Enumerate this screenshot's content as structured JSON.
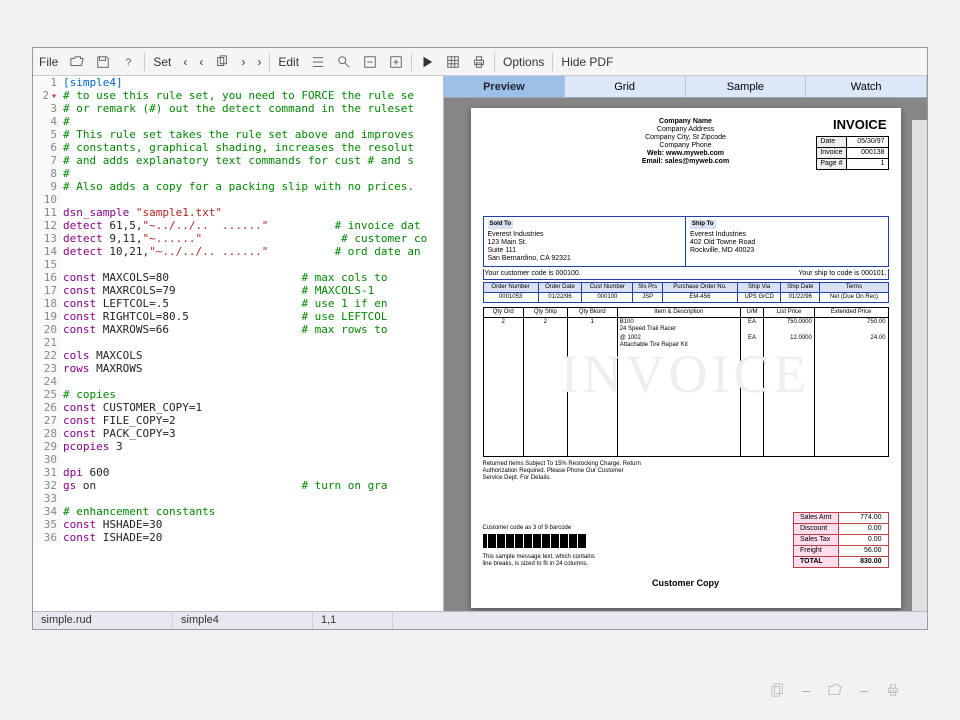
{
  "toolbar": {
    "file": "File",
    "set": "Set",
    "edit": "Edit",
    "options": "Options",
    "hide_pdf": "Hide PDF"
  },
  "code": [
    {
      "n": 1,
      "c": "section",
      "t": "[simple4]"
    },
    {
      "n": 2,
      "c": "comment",
      "t": "# to use this rule set, you need to FORCE the rule se",
      "fold": true
    },
    {
      "n": 3,
      "c": "comment",
      "t": "# or remark (#) out the detect command in the ruleset"
    },
    {
      "n": 4,
      "c": "comment",
      "t": "#"
    },
    {
      "n": 5,
      "c": "comment",
      "t": "# This rule set takes the rule set above and improves"
    },
    {
      "n": 6,
      "c": "comment",
      "t": "# constants, graphical shading, increases the resolut"
    },
    {
      "n": 7,
      "c": "comment",
      "t": "# and adds explanatory text commands for cust # and s"
    },
    {
      "n": 8,
      "c": "comment",
      "t": "#"
    },
    {
      "n": 9,
      "c": "comment",
      "t": "# Also adds a copy for a packing slip with no prices."
    },
    {
      "n": 10,
      "c": "",
      "t": ""
    },
    {
      "n": 11,
      "c": "mixed",
      "t": [
        "kw:dsn_sample ",
        "str:\"sample1.txt\""
      ]
    },
    {
      "n": 12,
      "c": "mixed",
      "t": [
        "kw:detect ",
        "num:61,5,",
        "str:\"~../../..  ......\"",
        "pad:          ",
        "cm:# invoice dat"
      ]
    },
    {
      "n": 13,
      "c": "mixed",
      "t": [
        "kw:detect ",
        "num:9,11,",
        "str:\"~......\"",
        "pad:                     ",
        "cm:# customer co"
      ]
    },
    {
      "n": 14,
      "c": "mixed",
      "t": [
        "kw:detect ",
        "num:10,21,",
        "str:\"~../../.. ......\"",
        "pad:          ",
        "cm:# ord date an"
      ]
    },
    {
      "n": 15,
      "c": "",
      "t": ""
    },
    {
      "n": 16,
      "c": "mixed",
      "t": [
        "kw:const ",
        "id:MAXCOLS=80",
        "pad:                    ",
        "cm:# max cols to"
      ]
    },
    {
      "n": 17,
      "c": "mixed",
      "t": [
        "kw:const ",
        "id:MAXRCOLS=79",
        "pad:                   ",
        "cm:# MAXCOLS-1"
      ]
    },
    {
      "n": 18,
      "c": "mixed",
      "t": [
        "kw:const ",
        "id:LEFTCOL=.5",
        "pad:                    ",
        "cm:# use 1 if en"
      ]
    },
    {
      "n": 19,
      "c": "mixed",
      "t": [
        "kw:const ",
        "id:RIGHTCOL=80.5",
        "pad:                 ",
        "cm:# use LEFTCOL"
      ]
    },
    {
      "n": 20,
      "c": "mixed",
      "t": [
        "kw:const ",
        "id:MAXROWS=66",
        "pad:                    ",
        "cm:# max rows to"
      ]
    },
    {
      "n": 21,
      "c": "",
      "t": ""
    },
    {
      "n": 22,
      "c": "mixed",
      "t": [
        "kw:cols ",
        "id:MAXCOLS"
      ]
    },
    {
      "n": 23,
      "c": "mixed",
      "t": [
        "kw:rows ",
        "id:MAXROWS"
      ]
    },
    {
      "n": 24,
      "c": "",
      "t": ""
    },
    {
      "n": 25,
      "c": "comment",
      "t": "# copies"
    },
    {
      "n": 26,
      "c": "mixed",
      "t": [
        "kw:const ",
        "id:CUSTOMER_COPY=1"
      ]
    },
    {
      "n": 27,
      "c": "mixed",
      "t": [
        "kw:const ",
        "id:FILE_COPY=2"
      ]
    },
    {
      "n": 28,
      "c": "mixed",
      "t": [
        "kw:const ",
        "id:PACK_COPY=3"
      ]
    },
    {
      "n": 29,
      "c": "mixed",
      "t": [
        "kw:pcopies ",
        "num:3"
      ]
    },
    {
      "n": 30,
      "c": "",
      "t": ""
    },
    {
      "n": 31,
      "c": "mixed",
      "t": [
        "kw:dpi ",
        "num:600"
      ]
    },
    {
      "n": 32,
      "c": "mixed",
      "t": [
        "kw:gs ",
        "id:on",
        "pad:                               ",
        "cm:# turn on gra"
      ]
    },
    {
      "n": 33,
      "c": "",
      "t": ""
    },
    {
      "n": 34,
      "c": "comment",
      "t": "# enhancement constants"
    },
    {
      "n": 35,
      "c": "mixed",
      "t": [
        "kw:const ",
        "id:HSHADE=30"
      ]
    },
    {
      "n": 36,
      "c": "mixed",
      "t": [
        "kw:const ",
        "id:ISHADE=20"
      ]
    }
  ],
  "status": {
    "file": "simple.rud",
    "section": "simple4",
    "pos": "1,1"
  },
  "tabs": [
    "Preview",
    "Grid",
    "Sample",
    "Watch"
  ],
  "invoice": {
    "company": {
      "name": "Company Name",
      "addr": "Company Address",
      "csz": "Company City, St Zipcode",
      "phone": "Company Phone",
      "web": "Web: www.myweb.com",
      "email": "Email: sales@myweb.com"
    },
    "title": "INVOICE",
    "meta": [
      [
        "Date",
        "05/30/97"
      ],
      [
        "Invoice",
        "000138"
      ],
      [
        "Page #",
        "1"
      ]
    ],
    "sold_to": {
      "lbl": "Sold To",
      "lines": [
        "Everest Industries",
        "123 Main St.",
        "Suite 111",
        "San Bernardino, CA 92321"
      ]
    },
    "ship_to": {
      "lbl": "Ship To",
      "lines": [
        "Everest Industries",
        "402 Old Towne Road",
        "Rockville, MD 40023"
      ]
    },
    "cust_code": "Your customer code is 000100.",
    "ship_code": "Your ship to code is 000101.",
    "hdr": {
      "cols": [
        "Order Number",
        "Order Date",
        "Cust Number",
        "Sls Prs",
        "Purchase Order No.",
        "Ship Via",
        "Ship Date",
        "Terms"
      ],
      "row": [
        "0001053",
        "01/22/96",
        "000100",
        "JSP",
        "EM-456",
        "UPS GrCD",
        "01/22/96",
        "Net (Due On Rec)"
      ]
    },
    "line_cols": [
      "Qty Ord",
      "Qty Ship",
      "Qty Bkord",
      "Item & Description",
      "U/M",
      "List Price",
      "Extended Price"
    ],
    "lines": [
      {
        "ord": "2",
        "ship": "2",
        "bk": "1",
        "item": "B100",
        "desc": "24 Speed Trail Racer",
        "um": "EA",
        "list": "750.0000",
        "ext": "750.00"
      },
      {
        "ord": "",
        "ship": "",
        "bk": "",
        "item": "@ 1002",
        "desc": "Attachable Tire Repair Kit",
        "um": "EA",
        "list": "12.0000",
        "ext": "24.00"
      }
    ],
    "line_note": "Returned Items Subject To 15% Restocking Charge. Return Authorization Required. Please Phone Our Customer Service Dept. For Details.",
    "watermark": "INVOICE",
    "barcode_label": "Customer code as 3 of 9 barcode",
    "note_text": "This sample message text, which contains line breaks, is sized to fit in 24 columns.",
    "totals": [
      [
        "Sales Amt",
        "774.00"
      ],
      [
        "Discount",
        "0.00"
      ],
      [
        "Sales Tax",
        "0.00"
      ],
      [
        "Freight",
        "56.00"
      ],
      [
        "TOTAL",
        "830.00"
      ]
    ],
    "copy": "Customer Copy"
  }
}
